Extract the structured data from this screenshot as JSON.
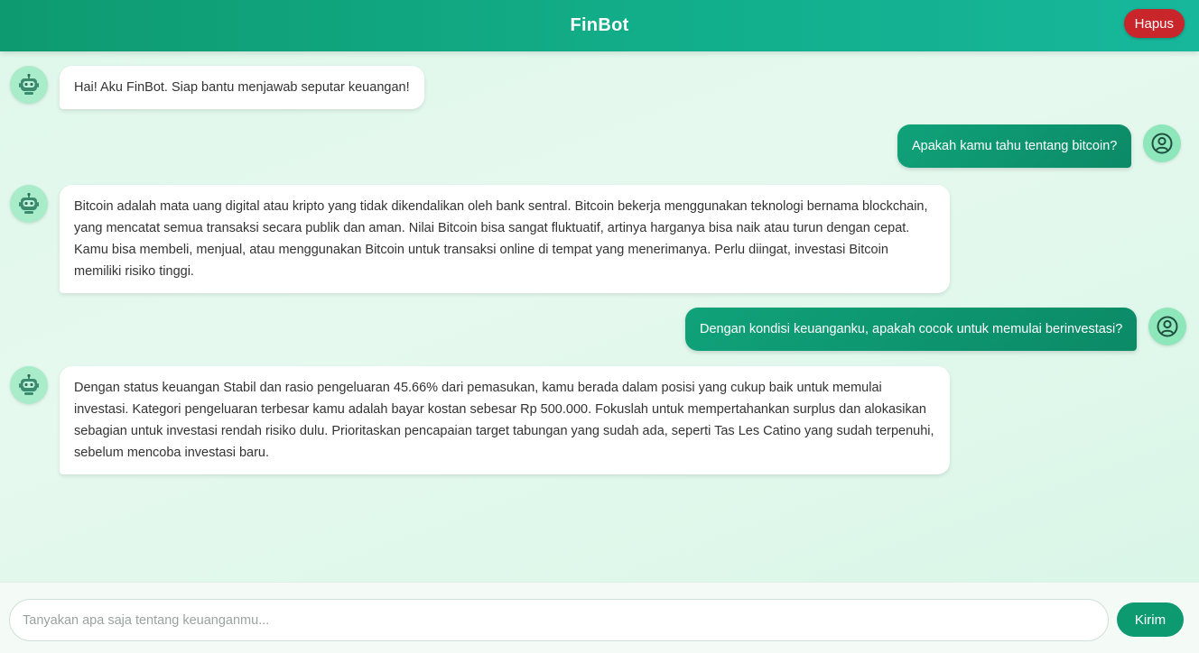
{
  "header": {
    "title": "FinBot",
    "clear_label": "Hapus"
  },
  "messages": [
    {
      "role": "bot",
      "avatar_icon": "robot-icon",
      "text": "Hai! Aku FinBot. Siap bantu menjawab seputar keuangan!"
    },
    {
      "role": "user",
      "avatar_icon": "user-circle-icon",
      "text": "Apakah kamu tahu tentang bitcoin?"
    },
    {
      "role": "bot",
      "avatar_icon": "robot-icon",
      "text": "Bitcoin adalah mata uang digital atau kripto yang tidak dikendalikan oleh bank sentral. Bitcoin bekerja menggunakan teknologi bernama blockchain, yang mencatat semua transaksi secara publik dan aman. Nilai Bitcoin bisa sangat fluktuatif, artinya harganya bisa naik atau turun dengan cepat. Kamu bisa membeli, menjual, atau menggunakan Bitcoin untuk transaksi online di tempat yang menerimanya. Perlu diingat, investasi Bitcoin memiliki risiko tinggi."
    },
    {
      "role": "user",
      "avatar_icon": "user-circle-icon",
      "text": "Dengan kondisi keuanganku, apakah cocok untuk memulai berinvestasi?"
    },
    {
      "role": "bot",
      "avatar_icon": "robot-icon",
      "text": "Dengan status keuangan Stabil dan rasio pengeluaran 45.66% dari pemasukan, kamu berada dalam posisi yang cukup baik untuk memulai investasi. Kategori pengeluaran terbesar kamu adalah bayar kostan sebesar Rp 500.000. Fokuslah untuk mempertahankan surplus dan alokasikan sebagian untuk investasi rendah risiko dulu. Prioritaskan pencapaian target tabungan yang sudah ada, seperti Tas Les Catino yang sudah terpenuhi, sebelum mencoba investasi baru."
    }
  ],
  "composer": {
    "placeholder": "Tanyakan apa saja tentang keuanganmu...",
    "value": "",
    "send_label": "Kirim"
  },
  "colors": {
    "header_start": "#0e9a70",
    "header_end": "#17b79c",
    "danger": "#c8262b",
    "user_bubble": "#10a27a",
    "avatar_bg": "#9ee8c4"
  }
}
